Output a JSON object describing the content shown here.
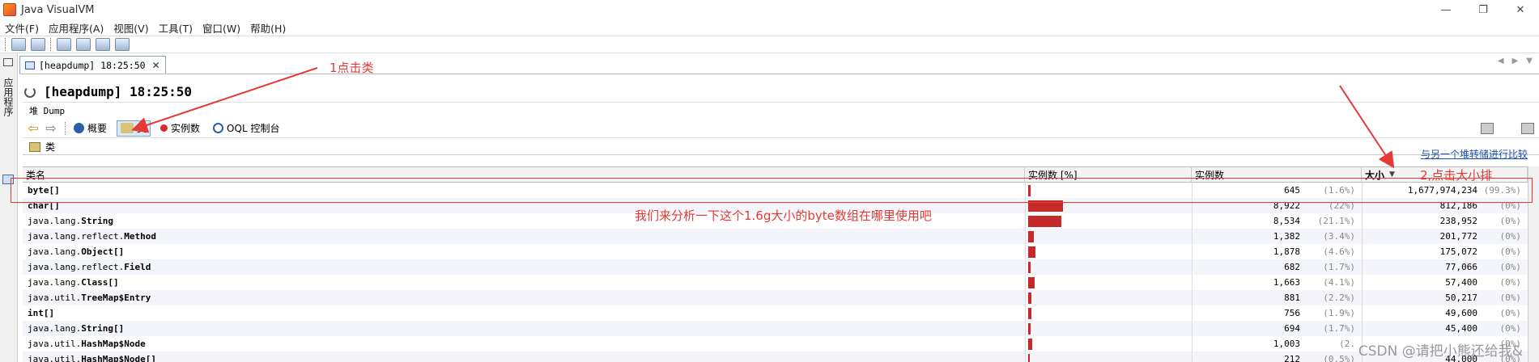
{
  "window": {
    "title": "Java VisualVM",
    "icons": [
      "minimize-icon",
      "restore-icon",
      "close-icon"
    ]
  },
  "menubar": [
    "文件(F)",
    "应用程序(A)",
    "视图(V)",
    "工具(T)",
    "窗口(W)",
    "帮助(H)"
  ],
  "sidebar": {
    "label": "应用程序"
  },
  "tab": {
    "label": "[heapdump] 18:25:50",
    "close": "✕"
  },
  "headline": "[heapdump] 18:25:50",
  "subtab": "堆 Dump",
  "views": [
    {
      "label": "概要",
      "icon": "info-icon"
    },
    {
      "label": "类",
      "icon": "class-icon",
      "active": true
    },
    {
      "label": "实例数",
      "icon": "instance-icon"
    },
    {
      "label": "OQL 控制台",
      "icon": "oql-icon"
    }
  ],
  "classbar": {
    "label": "类",
    "compare_link": "与另一个堆转储进行比较"
  },
  "table": {
    "headers": {
      "name": "类名",
      "bar": "实例数 [%]",
      "count": "实例数",
      "size": "大小"
    },
    "rows": [
      {
        "name": "byte[]",
        "pct_num": 1.6,
        "count": "645",
        "count_pct": "(1.6%)",
        "size": "1,677,974,234",
        "size_pct": "(99.3%)"
      },
      {
        "name": "char[]",
        "pct_num": 22,
        "count": "8,922",
        "count_pct": "(22%)",
        "size": "812,186",
        "size_pct": "(0%)"
      },
      {
        "name": "java.lang.String",
        "pct_num": 21.1,
        "count": "8,534",
        "count_pct": "(21.1%)",
        "size": "238,952",
        "size_pct": "(0%)"
      },
      {
        "name": "java.lang.reflect.Method",
        "pct_num": 3.4,
        "count": "1,382",
        "count_pct": "(3.4%)",
        "size": "201,772",
        "size_pct": "(0%)"
      },
      {
        "name": "java.lang.Object[]",
        "pct_num": 4.6,
        "count": "1,878",
        "count_pct": "(4.6%)",
        "size": "175,072",
        "size_pct": "(0%)"
      },
      {
        "name": "java.lang.reflect.Field",
        "pct_num": 1.7,
        "count": "682",
        "count_pct": "(1.7%)",
        "size": "77,066",
        "size_pct": "(0%)"
      },
      {
        "name": "java.lang.Class[]",
        "pct_num": 4.1,
        "count": "1,663",
        "count_pct": "(4.1%)",
        "size": "57,400",
        "size_pct": "(0%)"
      },
      {
        "name": "java.util.TreeMap$Entry",
        "pct_num": 2.2,
        "count": "881",
        "count_pct": "(2.2%)",
        "size": "50,217",
        "size_pct": "(0%)"
      },
      {
        "name": "int[]",
        "pct_num": 1.9,
        "count": "756",
        "count_pct": "(1.9%)",
        "size": "49,600",
        "size_pct": "(0%)"
      },
      {
        "name": "java.lang.String[]",
        "pct_num": 1.7,
        "count": "694",
        "count_pct": "(1.7%)",
        "size": "45,400",
        "size_pct": "(0%)"
      },
      {
        "name": "java.util.HashMap$Node",
        "pct_num": 2.5,
        "count": "1,003",
        "count_pct": "(2.",
        "size": "",
        "size_pct": "(0%)"
      },
      {
        "name": "java.util.HashMap$Node[]",
        "pct_num": 0.5,
        "count": "212",
        "count_pct": "(0.5%)",
        "size": "44,000",
        "size_pct": "(0%)"
      }
    ]
  },
  "annotations": {
    "step1": "1点击类",
    "step2": "2,点击大小排",
    "note": "我们来分析一下这个1.6g大小的byte数组在哪里使用吧",
    "color": "#e53935"
  },
  "watermark": "CSDN @请把小熊还给我&"
}
